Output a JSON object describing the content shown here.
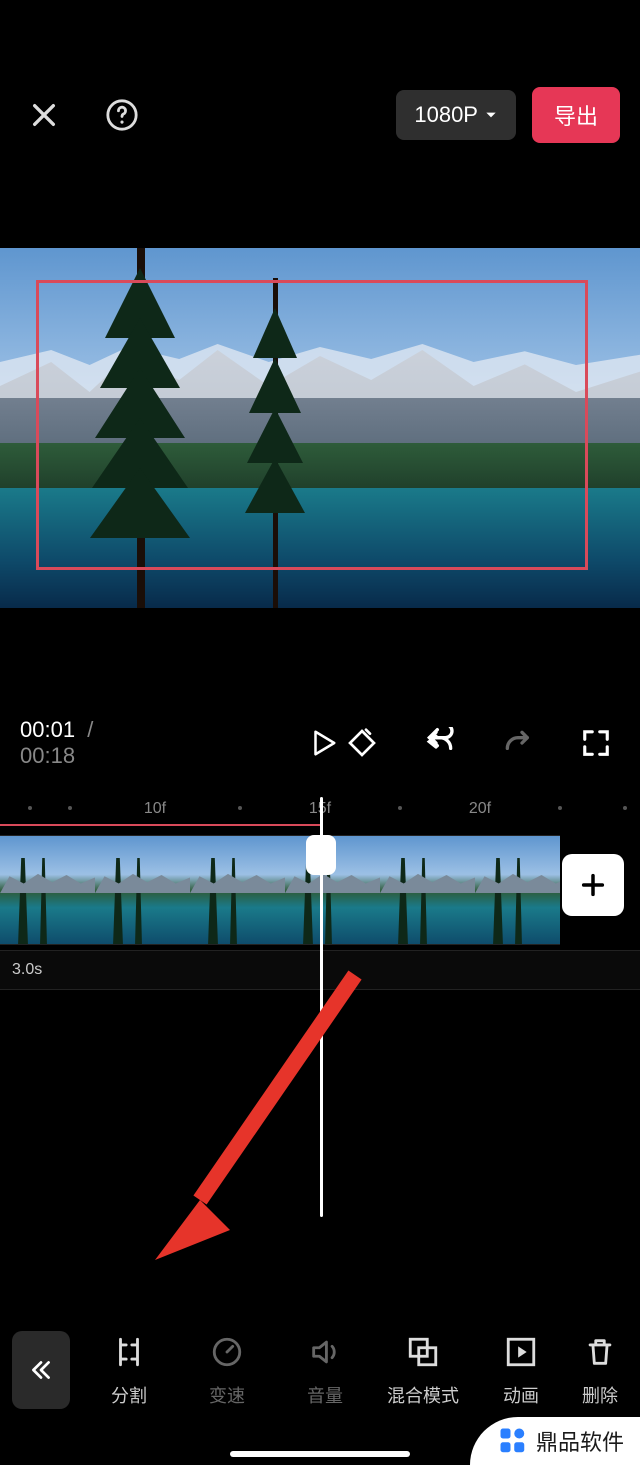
{
  "header": {
    "resolution_label": "1080P",
    "export_label": "导出"
  },
  "playback": {
    "current_time": "00:01",
    "separator": "/",
    "duration": "00:18"
  },
  "timeline": {
    "ruler_labels": [
      "10f",
      "15f",
      "20f"
    ],
    "overlay_duration": "3.0s"
  },
  "toolbar": {
    "items": [
      {
        "id": "split",
        "label": "分割",
        "dim": false
      },
      {
        "id": "speed",
        "label": "变速",
        "dim": true
      },
      {
        "id": "volume",
        "label": "音量",
        "dim": true
      },
      {
        "id": "blend",
        "label": "混合模式",
        "dim": false
      },
      {
        "id": "anim",
        "label": "动画",
        "dim": false
      },
      {
        "id": "delete",
        "label": "删除",
        "dim": false
      }
    ]
  },
  "watermark": {
    "text": "鼎品软件"
  }
}
